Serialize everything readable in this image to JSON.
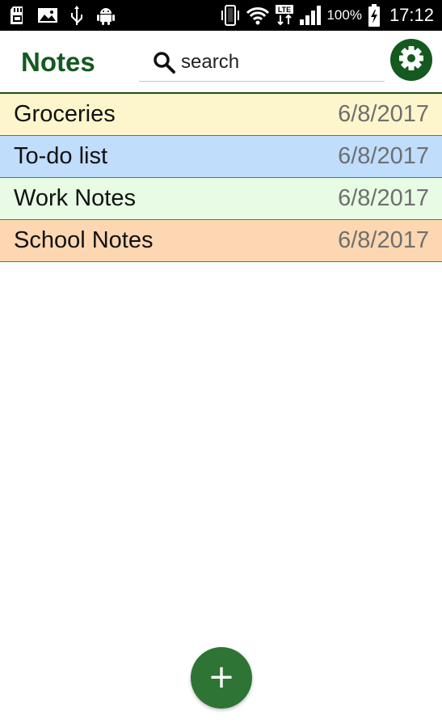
{
  "status_bar": {
    "battery_percent": "100%",
    "time": "17:12",
    "network_label": "LTE",
    "icons": [
      "sd-card-icon",
      "image-icon",
      "usb-icon",
      "android-icon",
      "vibrate-icon",
      "wifi-icon",
      "lte-icon",
      "signal-icon",
      "battery-charging-icon"
    ]
  },
  "header": {
    "title": "Notes",
    "search_placeholder": "search",
    "settings_icon": "gear-icon",
    "accent_color": "#14591f"
  },
  "notes": [
    {
      "title": "Groceries",
      "date": "6/8/2017",
      "color": "#fdf6cc"
    },
    {
      "title": "To-do list",
      "date": "6/8/2017",
      "color": "#c0ddfb"
    },
    {
      "title": "Work Notes",
      "date": "6/8/2017",
      "color": "#e7fbe5"
    },
    {
      "title": "School Notes",
      "date": "6/8/2017",
      "color": "#fcd7b1"
    }
  ],
  "fab": {
    "label": "+",
    "icon": "plus-icon",
    "color": "#2e7434"
  }
}
